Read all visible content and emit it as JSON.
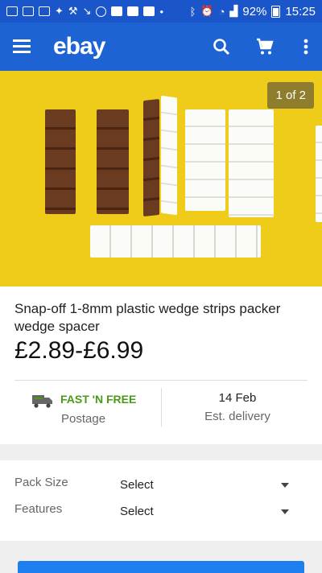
{
  "status_bar": {
    "battery": "92%",
    "time": "15:25"
  },
  "app_bar": {
    "logo": "ebay"
  },
  "gallery": {
    "counter": "1 of 2"
  },
  "product": {
    "title": "Snap-off 1-8mm plastic wedge strips packer wedge spacer",
    "price": "£2.89-£6.99"
  },
  "shipping": {
    "badge": "FAST 'N FREE",
    "label": "Postage"
  },
  "delivery": {
    "date": "14 Feb",
    "label": "Est. delivery"
  },
  "options": [
    {
      "label": "Pack Size",
      "value": "Select"
    },
    {
      "label": "Features",
      "value": "Select"
    }
  ],
  "colors": {
    "brand_blue": "#1d63d4",
    "status_blue": "#1a56c9",
    "hero_yellow": "#efcc19",
    "fast_green": "#4a9a1a"
  }
}
